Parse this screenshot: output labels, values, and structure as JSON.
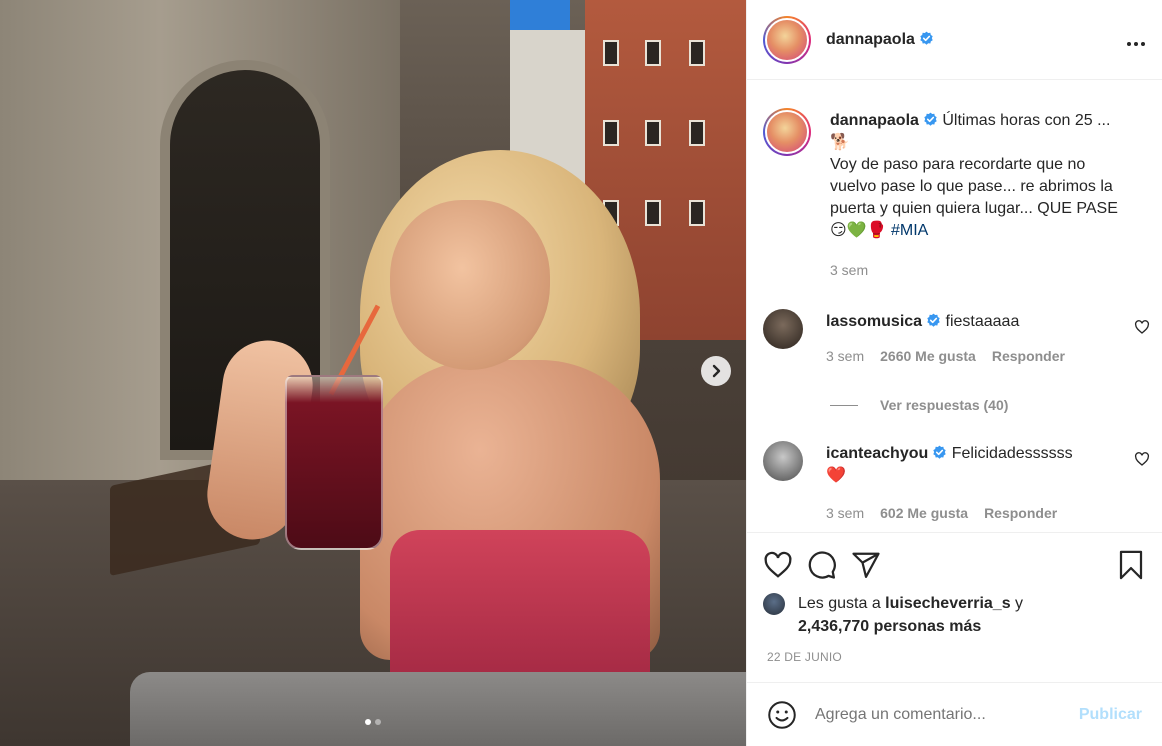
{
  "post": {
    "username": "dannapaola",
    "more_icon": "more-horizontal-icon",
    "carousel": {
      "dots_total": 2,
      "active_index": 0
    }
  },
  "caption": {
    "username": "dannapaola",
    "text_line1": "Últimas horas con 25 ...",
    "emoji_line1": "🐕",
    "text_body": "Voy de paso para recordarte que no vuelvo pase lo que pase... re abrimos la puerta y quien quiera lugar... QUE PASE",
    "emojis_end": "😏💚🥊",
    "hashtag": "#MIA",
    "time": "3 sem"
  },
  "comments": [
    {
      "username": "lassomusica",
      "text": "fiestaaaaa",
      "time": "3 sem",
      "likes": "2660 Me gusta",
      "reply": "Responder",
      "view_replies": "Ver respuestas (40)"
    },
    {
      "username": "icanteachyou",
      "text": "Felicidadessssss",
      "emoji": "❤️",
      "time": "3 sem",
      "likes": "602 Me gusta",
      "reply": "Responder"
    }
  ],
  "likes": {
    "prefix": "Les gusta a ",
    "user": "luisecheverria_s",
    "suffix": " y",
    "others": "2,436,770 personas más"
  },
  "date": "22 DE JUNIO",
  "add_comment": {
    "placeholder": "Agrega un comentario...",
    "publish": "Publicar"
  },
  "colors": {
    "verified": "#3897f0",
    "link": "#00376b",
    "muted": "#8e8e8e",
    "publish_disabled": "#b2dffc"
  }
}
